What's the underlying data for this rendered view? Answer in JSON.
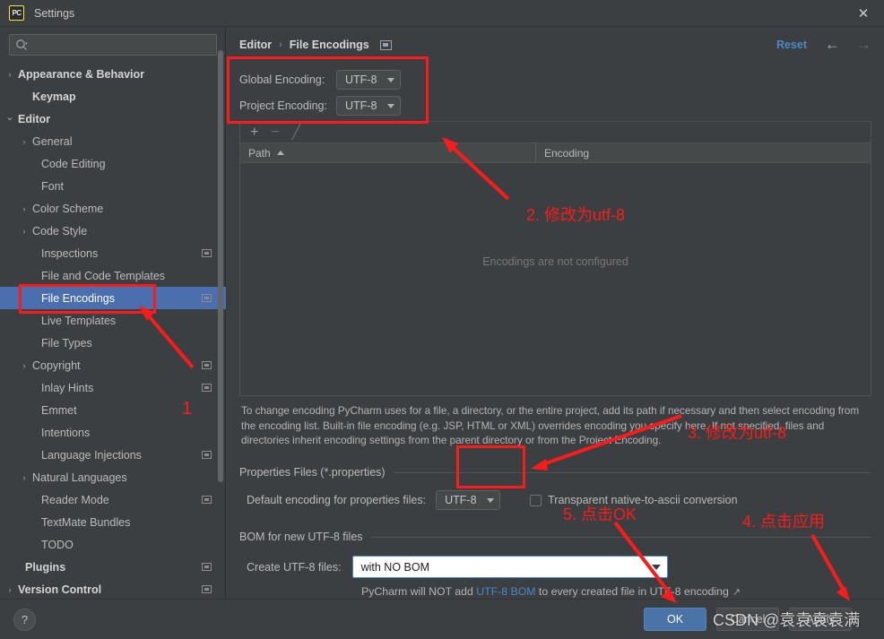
{
  "window": {
    "title": "Settings",
    "logo_text": "PC",
    "close_icon": "✕"
  },
  "search": {
    "placeholder": "",
    "value": "",
    "icon": "search-icon"
  },
  "sidebar": {
    "items": [
      {
        "label": "Appearance & Behavior",
        "indent": 20,
        "arrow": "›",
        "bold": true,
        "badge": false,
        "selected": false
      },
      {
        "label": "Keymap",
        "indent": 36,
        "arrow": "",
        "bold": true,
        "badge": false,
        "selected": false
      },
      {
        "label": "Editor",
        "indent": 20,
        "arrow": "⌄",
        "bold": true,
        "badge": false,
        "selected": false
      },
      {
        "label": "General",
        "indent": 36,
        "arrow": "›",
        "bold": false,
        "badge": false,
        "selected": false
      },
      {
        "label": "Code Editing",
        "indent": 46,
        "arrow": "",
        "bold": false,
        "badge": false,
        "selected": false
      },
      {
        "label": "Font",
        "indent": 46,
        "arrow": "",
        "bold": false,
        "badge": false,
        "selected": false
      },
      {
        "label": "Color Scheme",
        "indent": 36,
        "arrow": "›",
        "bold": false,
        "badge": false,
        "selected": false
      },
      {
        "label": "Code Style",
        "indent": 36,
        "arrow": "›",
        "bold": false,
        "badge": false,
        "selected": false
      },
      {
        "label": "Inspections",
        "indent": 46,
        "arrow": "",
        "bold": false,
        "badge": true,
        "selected": false
      },
      {
        "label": "File and Code Templates",
        "indent": 46,
        "arrow": "",
        "bold": false,
        "badge": false,
        "selected": false
      },
      {
        "label": "File Encodings",
        "indent": 46,
        "arrow": "",
        "bold": false,
        "badge": true,
        "selected": true
      },
      {
        "label": "Live Templates",
        "indent": 46,
        "arrow": "",
        "bold": false,
        "badge": false,
        "selected": false
      },
      {
        "label": "File Types",
        "indent": 46,
        "arrow": "",
        "bold": false,
        "badge": false,
        "selected": false
      },
      {
        "label": "Copyright",
        "indent": 36,
        "arrow": "›",
        "bold": false,
        "badge": true,
        "selected": false
      },
      {
        "label": "Inlay Hints",
        "indent": 46,
        "arrow": "",
        "bold": false,
        "badge": true,
        "selected": false
      },
      {
        "label": "Emmet",
        "indent": 46,
        "arrow": "",
        "bold": false,
        "badge": false,
        "selected": false
      },
      {
        "label": "Intentions",
        "indent": 46,
        "arrow": "",
        "bold": false,
        "badge": false,
        "selected": false
      },
      {
        "label": "Language Injections",
        "indent": 46,
        "arrow": "",
        "bold": false,
        "badge": true,
        "selected": false
      },
      {
        "label": "Natural Languages",
        "indent": 36,
        "arrow": "›",
        "bold": false,
        "badge": false,
        "selected": false
      },
      {
        "label": "Reader Mode",
        "indent": 46,
        "arrow": "",
        "bold": false,
        "badge": true,
        "selected": false
      },
      {
        "label": "TextMate Bundles",
        "indent": 46,
        "arrow": "",
        "bold": false,
        "badge": false,
        "selected": false
      },
      {
        "label": "TODO",
        "indent": 46,
        "arrow": "",
        "bold": false,
        "badge": false,
        "selected": false
      },
      {
        "label": "Plugins",
        "indent": 28,
        "arrow": "",
        "bold": true,
        "badge": true,
        "selected": false
      },
      {
        "label": "Version Control",
        "indent": 20,
        "arrow": "›",
        "bold": true,
        "badge": true,
        "selected": false
      }
    ]
  },
  "content": {
    "breadcrumb": {
      "parent": "Editor",
      "separator": "›",
      "current": "File Encodings"
    },
    "reset_label": "Reset",
    "nav_back_icon": "←",
    "nav_forward_icon": "→",
    "global_encoding": {
      "label": "Global Encoding:",
      "value": "UTF-8"
    },
    "project_encoding": {
      "label": "Project Encoding:",
      "value": "UTF-8"
    },
    "toolbar": {
      "add": "+",
      "remove": "−",
      "edit": "╱"
    },
    "table": {
      "columns": [
        "Path",
        "Encoding"
      ],
      "rows": [],
      "empty_message": "Encodings are not configured"
    },
    "help_text": "To change encoding PyCharm uses for a file, a directory, or the entire project, add its path if necessary and then select encoding from the encoding list. Built-in file encoding (e.g. JSP, HTML or XML) overrides encoding you specify here. If not specified, files and directories inherit encoding settings from the parent directory or from the Project Encoding.",
    "properties_section": {
      "title": "Properties Files (*.properties)",
      "default_encoding_label": "Default encoding for properties files:",
      "default_encoding_value": "UTF-8",
      "transparent_label": "Transparent native-to-ascii conversion",
      "transparent_checked": false
    },
    "bom_section": {
      "title": "BOM for new UTF-8 files",
      "create_label": "Create UTF-8 files:",
      "create_value": "with NO BOM",
      "note_prefix": "PyCharm will NOT add ",
      "note_link": "UTF-8 BOM",
      "note_suffix": " to every created file in UTF-8 encoding",
      "external_link_icon": "↗"
    }
  },
  "footer": {
    "help_icon": "?",
    "ok_label": "OK",
    "cancel_label": "Cancel",
    "apply_label": "Apply"
  },
  "annotations": {
    "step1": "1",
    "step2": "2. 修改为utf-8",
    "step3": "3. 修改为utf-8",
    "step4": "4. 点击应用",
    "step5": "5. 点击OK",
    "color": "#fb1b1b"
  },
  "watermark": {
    "text": "CSDN @袁袁袁袁满"
  }
}
